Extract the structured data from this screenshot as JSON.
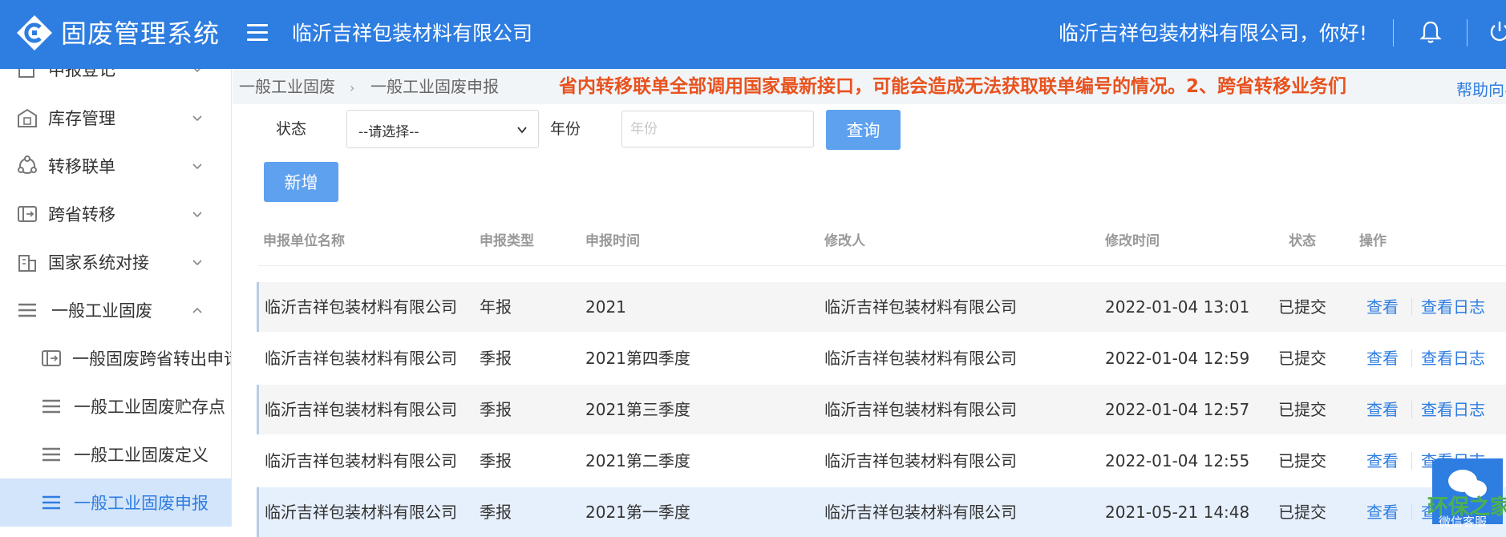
{
  "header": {
    "app_title": "固废管理系统",
    "company": "临沂吉祥包装材料有限公司",
    "greeting": "临沂吉祥包装材料有限公司，你好!"
  },
  "sidebar": {
    "items": [
      {
        "label": "申报登记",
        "icon": "form-icon"
      },
      {
        "label": "库存管理",
        "icon": "warehouse-icon"
      },
      {
        "label": "转移联单",
        "icon": "transfer-icon"
      },
      {
        "label": "跨省转移",
        "icon": "cross-province-icon"
      },
      {
        "label": "国家系统对接",
        "icon": "building-icon"
      },
      {
        "label": "一般工业固废",
        "icon": "list-icon"
      }
    ],
    "sub_items": [
      {
        "label": "一般固废跨省转出申请",
        "icon": "export-icon"
      },
      {
        "label": "一般工业固废贮存点",
        "icon": "list-icon"
      },
      {
        "label": "一般工业固废定义",
        "icon": "list-icon"
      },
      {
        "label": "一般工业固废申报",
        "icon": "list-icon"
      }
    ]
  },
  "breadcrumb": {
    "items": [
      "一般工业固废",
      "一般工业固废申报"
    ],
    "notice": "省内转移联单全部调用国家最新接口，可能会造成无法获取联单编号的情况。2、跨省转移业务们",
    "help": "帮助向导"
  },
  "filter": {
    "status_label": "状态",
    "status_value": "--请选择--",
    "year_label": "年份",
    "year_placeholder": "年份",
    "query_button": "查询",
    "add_button": "新增"
  },
  "table": {
    "columns": [
      "申报单位名称",
      "申报类型",
      "申报时间",
      "修改人",
      "修改时间",
      "状态",
      "操作"
    ],
    "rows": [
      {
        "unit": "临沂吉祥包装材料有限公司",
        "type": "年报",
        "period": "2021",
        "modifier": "临沂吉祥包装材料有限公司",
        "modified": "2022-01-04 13:01",
        "status": "已提交",
        "view": "查看",
        "log": "查看日志"
      },
      {
        "unit": "临沂吉祥包装材料有限公司",
        "type": "季报",
        "period": "2021第四季度",
        "modifier": "临沂吉祥包装材料有限公司",
        "modified": "2022-01-04 12:59",
        "status": "已提交",
        "view": "查看",
        "log": "查看日志"
      },
      {
        "unit": "临沂吉祥包装材料有限公司",
        "type": "季报",
        "period": "2021第三季度",
        "modifier": "临沂吉祥包装材料有限公司",
        "modified": "2022-01-04 12:57",
        "status": "已提交",
        "view": "查看",
        "log": "查看日志"
      },
      {
        "unit": "临沂吉祥包装材料有限公司",
        "type": "季报",
        "period": "2021第二季度",
        "modifier": "临沂吉祥包装材料有限公司",
        "modified": "2022-01-04 12:55",
        "status": "已提交",
        "view": "查看",
        "log": "查看日志"
      },
      {
        "unit": "临沂吉祥包装材料有限公司",
        "type": "季报",
        "period": "2021第一季度",
        "modifier": "临沂吉祥包装材料有限公司",
        "modified": "2021-05-21 14:48",
        "status": "已提交",
        "view": "查看",
        "log": "查看日志"
      }
    ]
  },
  "watermark": {
    "text": "环保之家",
    "sub": "微信客服"
  },
  "colors": {
    "primary": "#2e7de1",
    "button": "#5ea1ef",
    "notice": "#e8521e",
    "active_nav": "#d3e5fb"
  }
}
